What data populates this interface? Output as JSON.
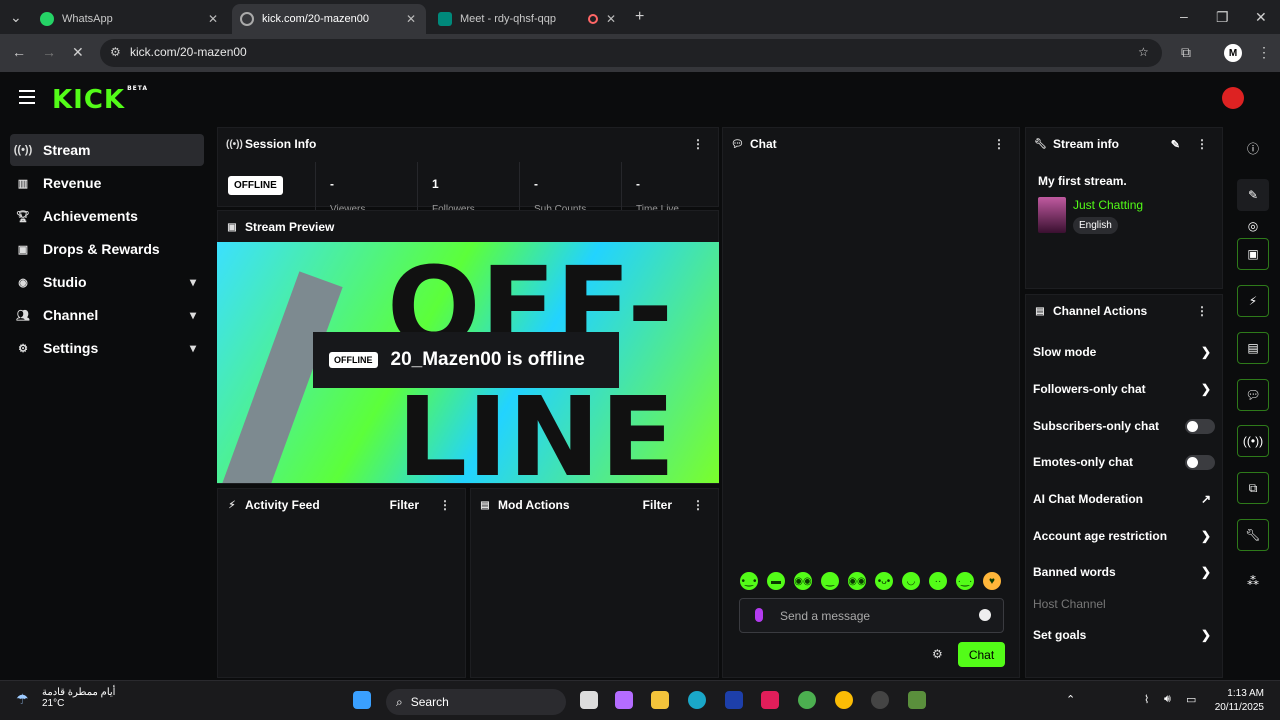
{
  "browser": {
    "tabs": [
      {
        "label": "WhatsApp"
      },
      {
        "label": "kick.com/20-mazen00"
      },
      {
        "label": "Meet - rdy-qhsf-qqp"
      }
    ],
    "url": "kick.com/20-mazen00",
    "profile_letter": "M"
  },
  "header": {
    "logo": "KICK",
    "beta": "BETA"
  },
  "sidebar": {
    "items": [
      {
        "label": "Stream"
      },
      {
        "label": "Revenue"
      },
      {
        "label": "Achievements"
      },
      {
        "label": "Drops & Rewards"
      },
      {
        "label": "Studio"
      },
      {
        "label": "Channel"
      },
      {
        "label": "Settings"
      }
    ]
  },
  "session": {
    "title": "Session Info",
    "badge": "OFFLINE",
    "stats": [
      {
        "value": "-",
        "label": "Viewers"
      },
      {
        "value": "1",
        "label": "Followers"
      },
      {
        "value": "-",
        "label": "Sub Counts"
      },
      {
        "value": "-",
        "label": "Time Live"
      }
    ]
  },
  "preview": {
    "title": "Stream Preview",
    "bg_top": "OFF-",
    "bg_bottom": "LINE",
    "badge": "OFFLINE",
    "status": "20_Mazen00 is offline"
  },
  "activity": {
    "title": "Activity Feed",
    "filter": "Filter"
  },
  "mod": {
    "title": "Mod Actions",
    "filter": "Filter"
  },
  "chat": {
    "title": "Chat",
    "placeholder": "Send a message",
    "send": "Chat"
  },
  "stream_info": {
    "title": "Stream info",
    "stream_title": "My first stream.",
    "category": "Just Chatting",
    "language": "English"
  },
  "channel_actions": {
    "title": "Channel Actions",
    "rows": [
      {
        "label": "Slow mode"
      },
      {
        "label": "Followers-only chat"
      },
      {
        "label": "Subscribers-only chat"
      },
      {
        "label": "Emotes-only chat"
      },
      {
        "label": "AI Chat Moderation"
      },
      {
        "label": "Account age restriction"
      },
      {
        "label": "Banned words"
      },
      {
        "label": "Host Channel"
      },
      {
        "label": "Set goals"
      }
    ]
  },
  "taskbar": {
    "weather_text": "أيام ممطرة قادمة",
    "temp": "21°C",
    "search": "Search",
    "time": "1:13 AM",
    "date": "20/11/2025"
  },
  "colors": {
    "accent": "#53fc18",
    "panel": "#131416"
  }
}
